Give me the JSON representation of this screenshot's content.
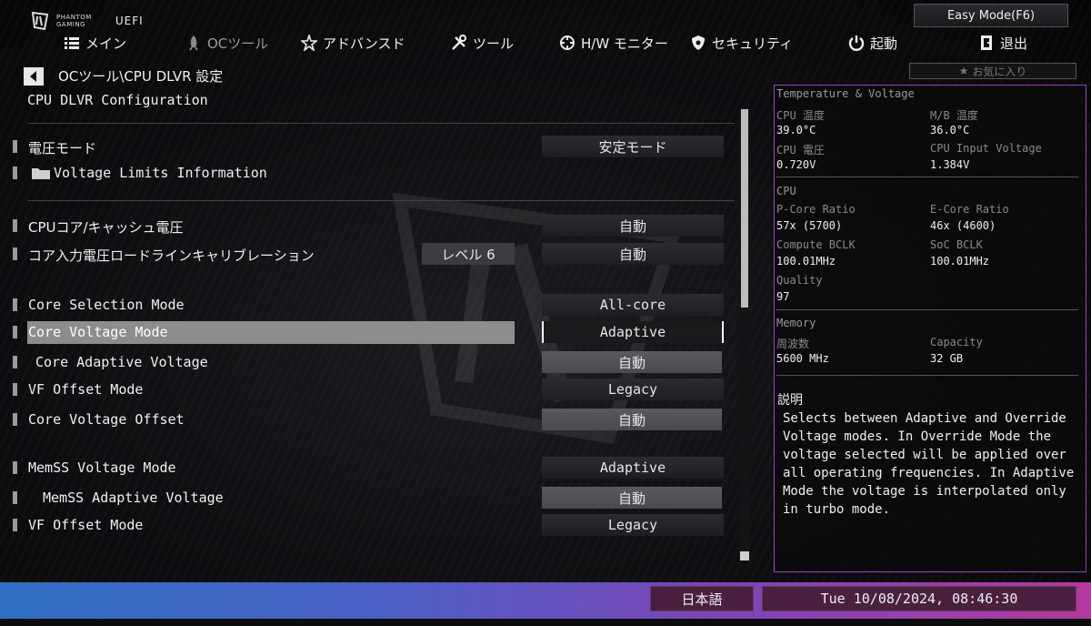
{
  "brand": {
    "line1": "PHANTOM",
    "line2": "GAMING",
    "uefi": "UEFI"
  },
  "easy_mode_label": "Easy Mode(F6)",
  "nav": [
    {
      "label": "メイン",
      "icon": "list-icon"
    },
    {
      "label": "OCツール",
      "icon": "rocket-icon",
      "active": true
    },
    {
      "label": "アドバンスド",
      "icon": "star-advanced-icon"
    },
    {
      "label": "ツール",
      "icon": "tools-icon"
    },
    {
      "label": "H/W モニター",
      "icon": "crosshair-icon"
    },
    {
      "label": "セキュリティ",
      "icon": "shield-icon"
    },
    {
      "label": "起動",
      "icon": "power-icon"
    },
    {
      "label": "退出",
      "icon": "exit-icon"
    }
  ],
  "breadcrumb": "OCツール\\CPU DLVR 設定",
  "section_title": "CPU DLVR Configuration",
  "favorite_label": "お気に入り",
  "rows": [
    {
      "label": "電圧モード",
      "value": "安定モード"
    },
    {
      "label": "Voltage Limits Information"
    },
    {
      "label": "CPUコア/キャッシュ電圧",
      "value": "自動"
    },
    {
      "label": "コア入力電圧ロードラインキャリブレーション",
      "level": "レベル 6",
      "value": "自動"
    },
    {
      "label": "Core Selection Mode",
      "value": "All-core"
    },
    {
      "label": "Core Voltage Mode",
      "value": "Adaptive"
    },
    {
      "label": "Core Adaptive Voltage",
      "value": "自動"
    },
    {
      "label": "VF Offset Mode",
      "value": "Legacy"
    },
    {
      "label": "Core Voltage Offset",
      "value": "自動"
    },
    {
      "label": "MemSS Voltage Mode",
      "value": "Adaptive"
    },
    {
      "label": "MemSS Adaptive Voltage",
      "value": "自動"
    },
    {
      "label": "VF Offset Mode",
      "value": "Legacy"
    }
  ],
  "panel": {
    "tv_header": "Temperature & Voltage",
    "cpu_temp_label": "CPU 温度",
    "cpu_temp": "39.0°C",
    "mb_temp_label": "M/B 温度",
    "mb_temp": "36.0°C",
    "cpu_volt_label": "CPU 電圧",
    "cpu_volt": "0.720V",
    "cpu_in_label": "CPU Input Voltage",
    "cpu_in": "1.384V",
    "cpu_header": "CPU",
    "pcore_label": "P-Core Ratio",
    "pcore": "57x (5700)",
    "ecore_label": "E-Core Ratio",
    "ecore": "46x (4600)",
    "cbclk_label": "Compute BCLK",
    "cbclk": "100.01MHz",
    "sbclk_label": "SoC BCLK",
    "sbclk": "100.01MHz",
    "quality_label": "Quality",
    "quality": "97",
    "mem_header": "Memory",
    "freq_label": "周波数",
    "freq": "5600 MHz",
    "cap_label": "Capacity",
    "cap": "32 GB",
    "desc_title": "説明",
    "desc": "Selects between Adaptive and Override Voltage modes. In Override Mode the voltage selected will be applied over all operating frequencies. In Adaptive Mode the voltage is interpolated only in turbo mode."
  },
  "footer": {
    "language": "日本語",
    "datetime": "Tue 10/08/2024, 08:46:30"
  },
  "colors": {
    "panel_border": "#9c3dbf",
    "highlight": "#8d8d8d"
  }
}
